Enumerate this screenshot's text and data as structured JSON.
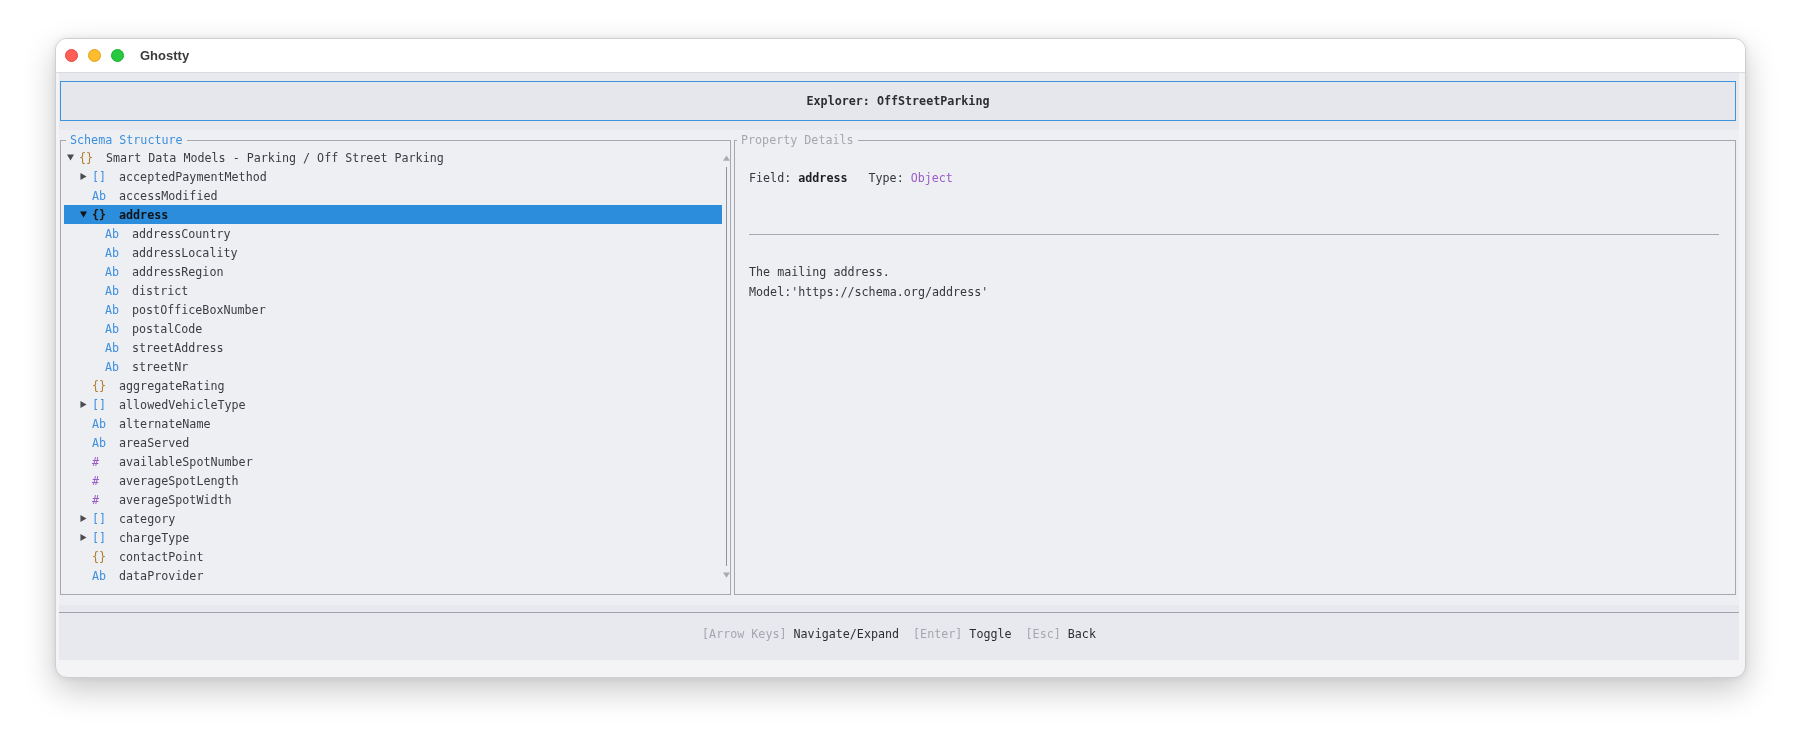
{
  "window": {
    "title": "Ghostty"
  },
  "header": {
    "title": "Explorer: OffStreetParking"
  },
  "schema_panel": {
    "title": "Schema Structure",
    "focused": true,
    "tree": [
      {
        "label": "Smart Data Models - Parking / Off Street Parking",
        "kind": "object",
        "type_mark": "{}",
        "expanded": true,
        "selected": false,
        "children": [
          {
            "label": "acceptedPaymentMethod",
            "kind": "array",
            "type_mark": "[]",
            "expanded": false,
            "selected": false
          },
          {
            "label": "accessModified",
            "kind": "string",
            "type_mark": "Ab",
            "selected": false
          },
          {
            "label": "address",
            "kind": "object",
            "type_mark": "{}",
            "expanded": true,
            "selected": true,
            "children": [
              {
                "label": "addressCountry",
                "kind": "string",
                "type_mark": "Ab",
                "selected": false
              },
              {
                "label": "addressLocality",
                "kind": "string",
                "type_mark": "Ab",
                "selected": false
              },
              {
                "label": "addressRegion",
                "kind": "string",
                "type_mark": "Ab",
                "selected": false
              },
              {
                "label": "district",
                "kind": "string",
                "type_mark": "Ab",
                "selected": false
              },
              {
                "label": "postOfficeBoxNumber",
                "kind": "string",
                "type_mark": "Ab",
                "selected": false
              },
              {
                "label": "postalCode",
                "kind": "string",
                "type_mark": "Ab",
                "selected": false
              },
              {
                "label": "streetAddress",
                "kind": "string",
                "type_mark": "Ab",
                "selected": false
              },
              {
                "label": "streetNr",
                "kind": "string",
                "type_mark": "Ab",
                "selected": false
              }
            ]
          },
          {
            "label": "aggregateRating",
            "kind": "object",
            "type_mark": "{}",
            "selected": false
          },
          {
            "label": "allowedVehicleType",
            "kind": "array",
            "type_mark": "[]",
            "expanded": false,
            "selected": false
          },
          {
            "label": "alternateName",
            "kind": "string",
            "type_mark": "Ab",
            "selected": false
          },
          {
            "label": "areaServed",
            "kind": "string",
            "type_mark": "Ab",
            "selected": false
          },
          {
            "label": "availableSpotNumber",
            "kind": "number",
            "type_mark": "#",
            "selected": false
          },
          {
            "label": "averageSpotLength",
            "kind": "number",
            "type_mark": "#",
            "selected": false
          },
          {
            "label": "averageSpotWidth",
            "kind": "number",
            "type_mark": "#",
            "selected": false
          },
          {
            "label": "category",
            "kind": "array",
            "type_mark": "[]",
            "expanded": false,
            "selected": false
          },
          {
            "label": "chargeType",
            "kind": "array",
            "type_mark": "[]",
            "expanded": false,
            "selected": false
          },
          {
            "label": "contactPoint",
            "kind": "object",
            "type_mark": "{}",
            "selected": false
          },
          {
            "label": "dataProvider",
            "kind": "string",
            "type_mark": "Ab",
            "selected": false
          }
        ]
      }
    ]
  },
  "details_panel": {
    "title": "Property Details",
    "focused": false,
    "field_label": "Field:",
    "field_value": "address",
    "type_label": "Type:",
    "type_value": "Object",
    "description": "The mailing address.\nModel:'https://schema.org/address'"
  },
  "footer": {
    "hints": [
      {
        "key": "[Arrow Keys]",
        "action": "Navigate/Expand"
      },
      {
        "key": "[Enter]",
        "action": "Toggle"
      },
      {
        "key": "[Esc]",
        "action": "Back"
      }
    ]
  }
}
